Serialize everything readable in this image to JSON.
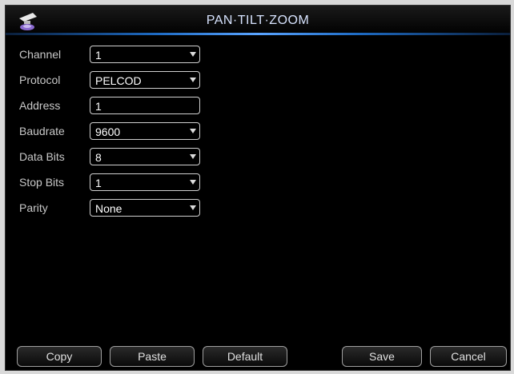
{
  "window": {
    "title": "PAN·TILT·ZOOM",
    "icon": "ptz-camera-icon"
  },
  "form": {
    "channel": {
      "label": "Channel",
      "value": "1"
    },
    "protocol": {
      "label": "Protocol",
      "value": "PELCOD"
    },
    "address": {
      "label": "Address",
      "value": "1"
    },
    "baudrate": {
      "label": "Baudrate",
      "value": "9600"
    },
    "data_bits": {
      "label": "Data Bits",
      "value": "8"
    },
    "stop_bits": {
      "label": "Stop Bits",
      "value": "1"
    },
    "parity": {
      "label": "Parity",
      "value": "None"
    }
  },
  "buttons": {
    "copy": "Copy",
    "paste": "Paste",
    "default": "Default",
    "save": "Save",
    "cancel": "Cancel"
  },
  "colors": {
    "accent": "#1e6bc4",
    "background": "#000000",
    "text": "#c8c8c8"
  }
}
